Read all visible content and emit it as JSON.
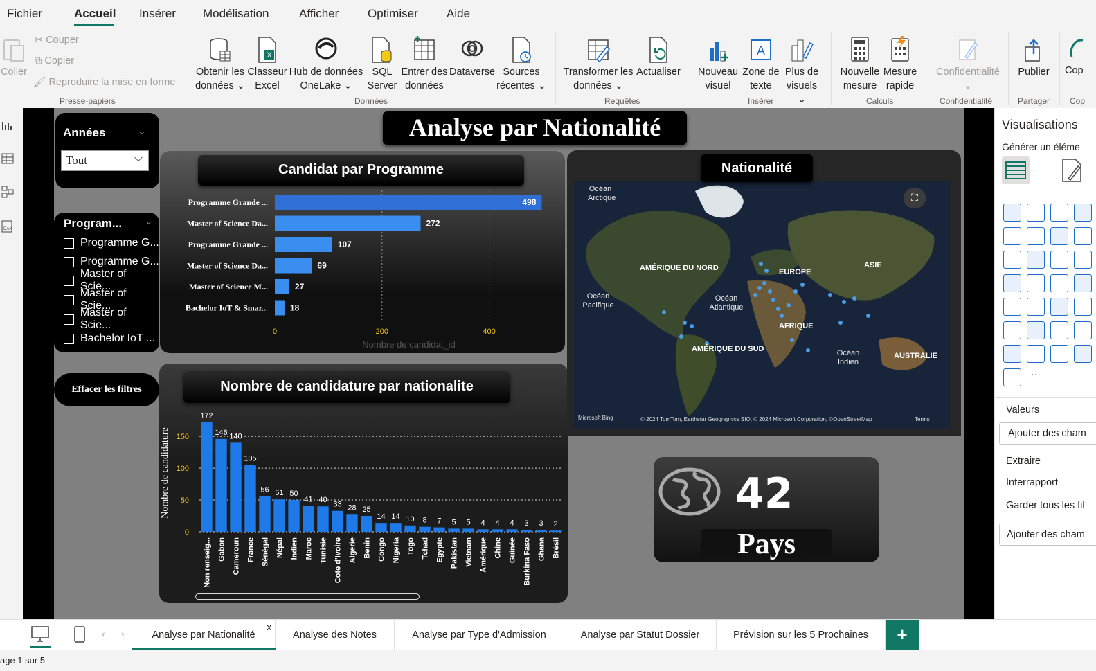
{
  "menu": {
    "items": [
      "Fichier",
      "Accueil",
      "Insérer",
      "Modélisation",
      "Afficher",
      "Optimiser",
      "Aide"
    ],
    "active": "Accueil"
  },
  "ribbon": {
    "clipboard": {
      "paste": "Coller",
      "cut": "Couper",
      "copy": "Copier",
      "format_painter": "Reproduire la mise en forme",
      "group": "Presse-papiers"
    },
    "data": {
      "get_data_1": "Obtenir les",
      "get_data_2": "données",
      "excel_1": "Classeur",
      "excel_2": "Excel",
      "onelake_1": "Hub de données",
      "onelake_2": "OneLake",
      "sql_1": "SQL",
      "sql_2": "Server",
      "enter_1": "Entrer des",
      "enter_2": "données",
      "dataverse": "Dataverse",
      "recent_1": "Sources",
      "recent_2": "récentes",
      "group": "Données"
    },
    "queries": {
      "transform_1": "Transformer les",
      "transform_2": "données",
      "refresh": "Actualiser",
      "group": "Requêtes"
    },
    "insert": {
      "visual_1": "Nouveau",
      "visual_2": "visuel",
      "textbox_1": "Zone de",
      "textbox_2": "texte",
      "more_1": "Plus de",
      "more_2": "visuels",
      "group": "Insérer"
    },
    "calc": {
      "measure_1": "Nouvelle",
      "measure_2": "mesure",
      "quick_1": "Mesure",
      "quick_2": "rapide",
      "group": "Calculs"
    },
    "sensitivity": {
      "label": "Confidentialité",
      "group": "Confidentialité"
    },
    "share": {
      "publish": "Publier",
      "group": "Partager"
    },
    "copilot": {
      "label": "Cop",
      "group": "Cop"
    }
  },
  "report": {
    "title": "Analyse par Nationalité",
    "years_slicer": {
      "title": "Années",
      "value": "Tout"
    },
    "program_slicer": {
      "title": "Program...",
      "items": [
        "Programme G...",
        "Programme G...",
        "Master of Scie...",
        "Master of Scie...",
        "Master of Scie...",
        "Bachelor IoT ..."
      ]
    },
    "clear_filters": "Effacer les filtres",
    "map": {
      "title": "Nationalité",
      "labels": {
        "arctic": "Océan Arctique",
        "north_america": "AMÉRIQUE DU NORD",
        "europe": "EUROPE",
        "asia": "ASIE",
        "pacific": "Océan Pacifique",
        "atlantic": "Océan Atlantique",
        "africa": "AFRIQUE",
        "south_america": "AMÉRIQUE DU SUD",
        "indian": "Océan Indien",
        "australia": "AUSTRALIE"
      },
      "attribution": "© 2024 TomTom, Earthstar Geographics SIO, © 2024 Microsoft Corporation, ©OpenStreetMap",
      "terms": "Terms",
      "bing": "Microsoft Bing"
    },
    "kpi": {
      "value": "42",
      "label": "Pays"
    }
  },
  "chart_data": [
    {
      "type": "bar",
      "title": "Candidat par Programme",
      "orientation": "horizontal",
      "categories": [
        "Programme Grande ...",
        "Master of Science Da...",
        "Programme Grande ...",
        "Master of Science Da...",
        "Master of Science M...",
        "Bachelor IoT & Smar..."
      ],
      "values": [
        498,
        272,
        107,
        69,
        27,
        18
      ],
      "xlabel": "Nombre de candidat_id",
      "xticks": [
        "0",
        "200",
        "400"
      ],
      "xlim": [
        0,
        500
      ]
    },
    {
      "type": "bar",
      "title": "Nombre de candidature par nationalite",
      "categories": [
        "Non renseig...",
        "Gabon",
        "Cameroun",
        "France",
        "Sénégal",
        "Népal",
        "Indien",
        "Maroc",
        "Tunisie",
        "Cote d'Ivoire",
        "Algerie",
        "Benin",
        "Congo",
        "Nigeria",
        "Togo",
        "Tchad",
        "Egypte",
        "Pakistan",
        "Vietnam",
        "Amérique",
        "Chine",
        "Guinée",
        "Burkina Faso",
        "Ghana",
        "Brésil"
      ],
      "values": [
        172,
        146,
        140,
        105,
        56,
        51,
        50,
        41,
        40,
        33,
        28,
        25,
        14,
        14,
        10,
        8,
        7,
        5,
        5,
        4,
        4,
        4,
        3,
        3,
        2
      ],
      "ylabel": "Nombre de candidature",
      "yticks": [
        "0",
        "50",
        "100",
        "150"
      ],
      "ylim": [
        0,
        185
      ]
    }
  ],
  "viz_pane": {
    "title": "Visualisations",
    "build": "Générer un éléme",
    "values": "Valeurs",
    "add_fields": "Ajouter des cham",
    "drill": "Extraire",
    "cross_report": "Interrapport",
    "keep_filters": "Garder tous les fil",
    "add_drill": "Ajouter des cham"
  },
  "tabs": [
    "Analyse par Nationalité",
    "Analyse des Notes",
    "Analyse par Type d'Admission",
    "Analyse par Statut Dossier",
    "Prévision sur les 5 Prochaines"
  ],
  "status": "age 1 sur 5",
  "colors": {
    "accent": "#117865",
    "bar": "#2f6fd6",
    "bar_light": "#3a8ef0",
    "card": "#1c1c1c"
  }
}
